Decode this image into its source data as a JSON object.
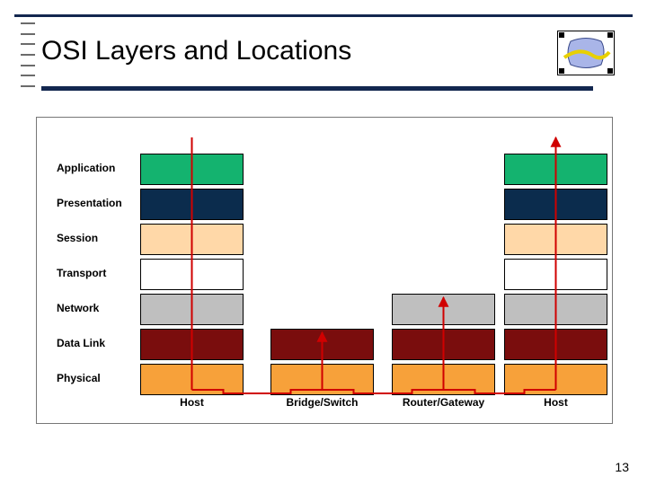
{
  "title": "OSI Layers and Locations",
  "page_number": "13",
  "layers": [
    {
      "name": "Application",
      "color": "#14b36f"
    },
    {
      "name": "Presentation",
      "color": "#0b2c4d"
    },
    {
      "name": "Session",
      "color": "#ffd8a8"
    },
    {
      "name": "Transport",
      "color": "#ffffff"
    },
    {
      "name": "Network",
      "color": "#bfbfbf"
    },
    {
      "name": "Data Link",
      "color": "#7a0d0d"
    },
    {
      "name": "Physical",
      "color": "#f7a13a"
    }
  ],
  "devices": [
    {
      "name": "Host",
      "layers": [
        0,
        1,
        2,
        3,
        4,
        5,
        6
      ]
    },
    {
      "name": "Bridge/Switch",
      "layers": [
        5,
        6
      ]
    },
    {
      "name": "Router/Gateway",
      "layers": [
        4,
        5,
        6
      ]
    },
    {
      "name": "Host",
      "layers": [
        0,
        1,
        2,
        3,
        4,
        5,
        6
      ]
    }
  ],
  "chart_data": {
    "type": "table",
    "title": "OSI Layers and Locations",
    "layers_top_to_bottom": [
      "Application",
      "Presentation",
      "Session",
      "Transport",
      "Network",
      "Data Link",
      "Physical"
    ],
    "devices_left_to_right": [
      "Host",
      "Bridge/Switch",
      "Router/Gateway",
      "Host"
    ],
    "device_top_layer": {
      "Host": "Application",
      "Bridge/Switch": "Data Link",
      "Router/Gateway": "Network"
    },
    "paths": [
      {
        "from_device": 0,
        "to_device": 1,
        "via_layer": "Physical",
        "up_to": "Data Link"
      },
      {
        "from_device": 1,
        "to_device": 2,
        "via_layer": "Physical",
        "up_to": "Network"
      },
      {
        "from_device": 2,
        "to_device": 3,
        "via_layer": "Physical",
        "up_to": "Application"
      }
    ]
  }
}
